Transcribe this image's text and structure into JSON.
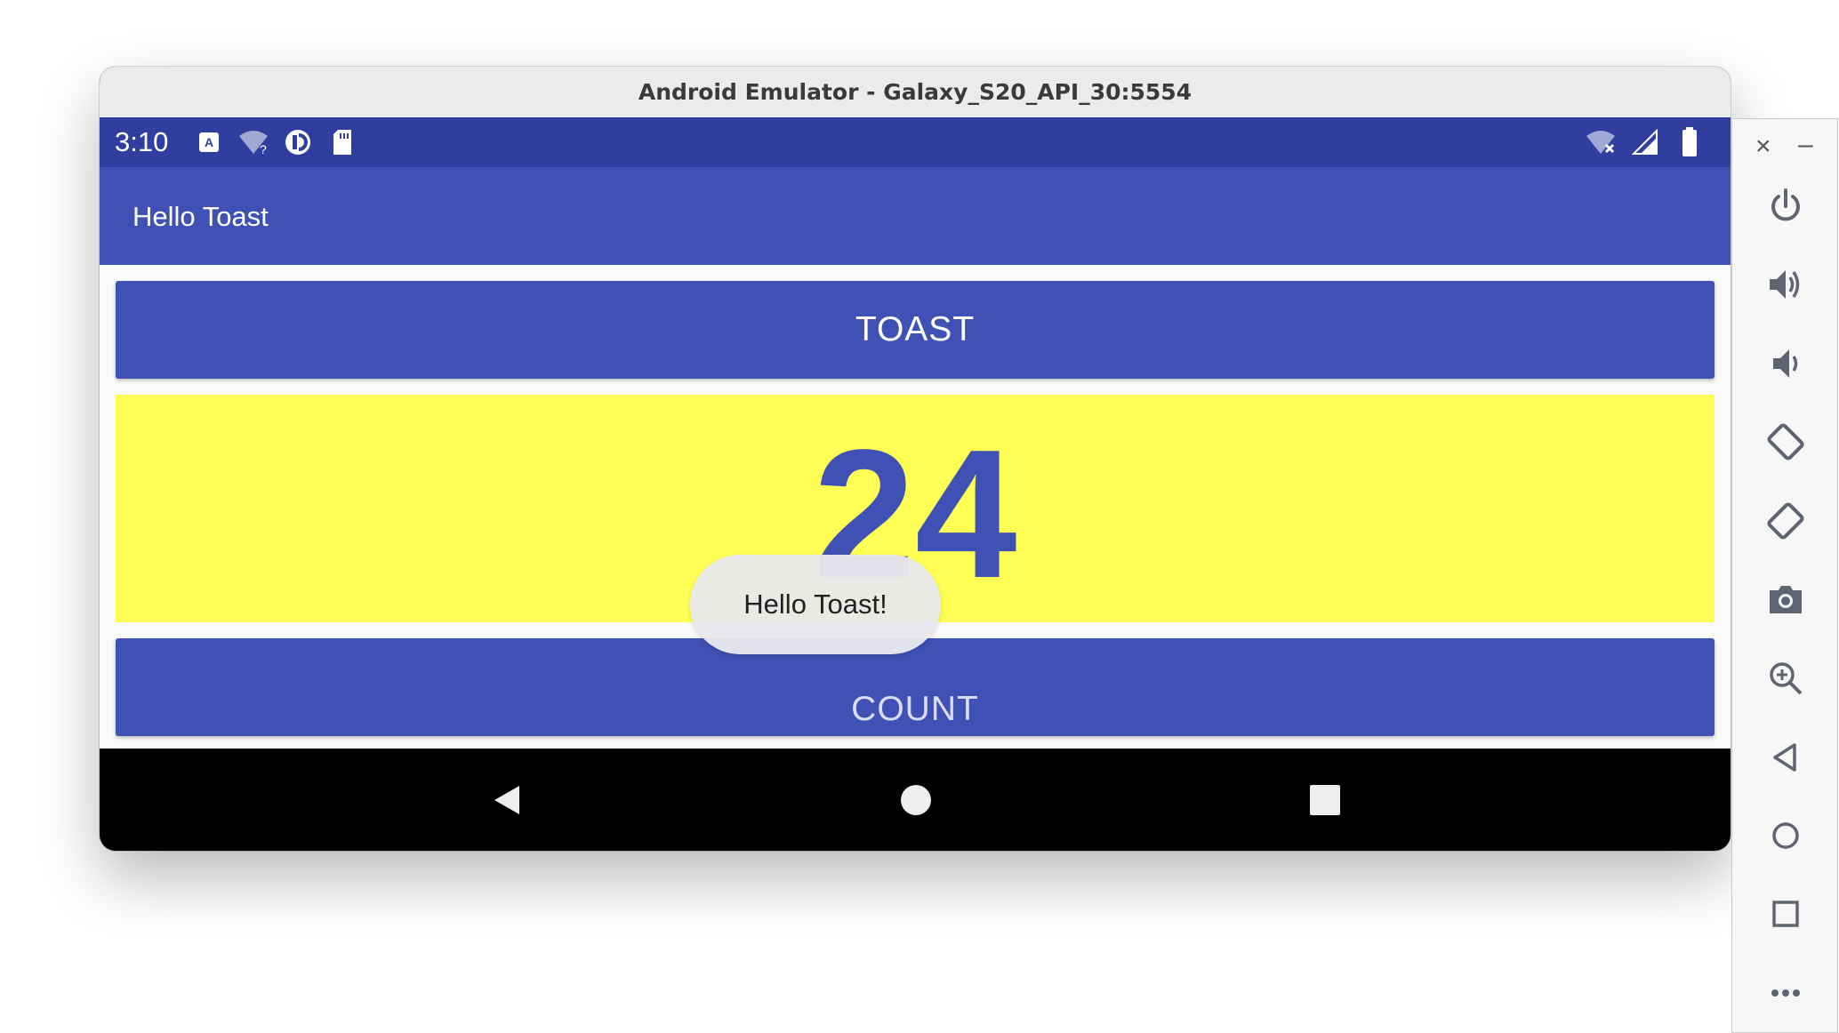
{
  "window": {
    "title": "Android Emulator - Galaxy_S20_API_30:5554"
  },
  "statusbar": {
    "time": "3:10"
  },
  "app": {
    "title": "Hello Toast",
    "toast_button_label": "TOAST",
    "count_value": "24",
    "count_button_label": "COUNT",
    "toast_message": "Hello Toast!"
  },
  "colors": {
    "status_bar": "#303f9f",
    "primary": "#3f51b5",
    "count_background": "#ffff55",
    "nav_bar": "#000000"
  },
  "sidebar": {
    "icons": [
      "close-icon",
      "minimize-icon",
      "power-icon",
      "volume-up-icon",
      "volume-down-icon",
      "rotate-left-icon",
      "rotate-right-icon",
      "camera-icon",
      "zoom-icon",
      "back-icon",
      "home-icon",
      "overview-icon",
      "more-icon"
    ]
  }
}
